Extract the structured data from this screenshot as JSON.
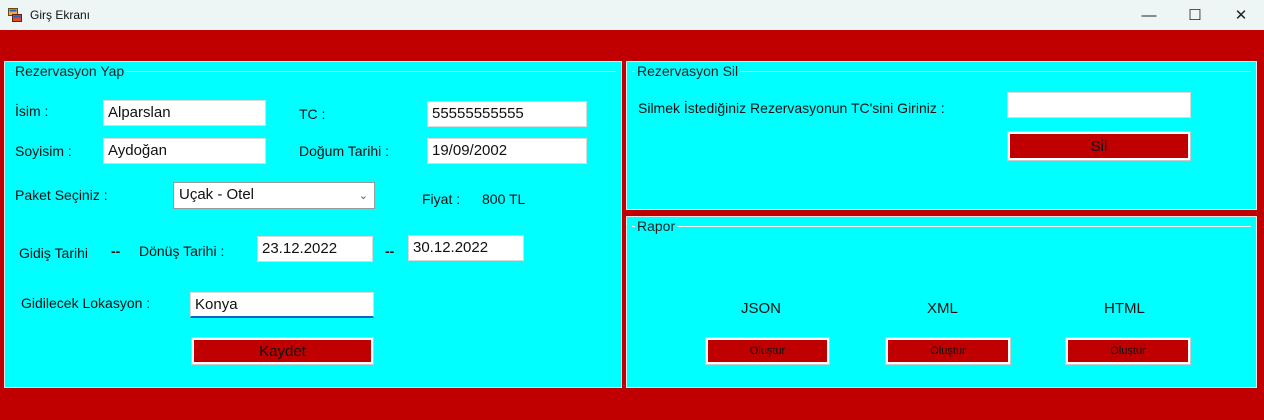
{
  "window": {
    "title": "Girş Ekranı",
    "minimize_glyph": "—",
    "maximize_glyph": "☐",
    "close_glyph": "✕"
  },
  "reservation": {
    "title": "Rezervasyon Yap",
    "name_label": "İsim :",
    "name_value": "Alparslan",
    "tc_label": "TC :",
    "tc_value": "55555555555",
    "surname_label": "Soyisim :",
    "surname_value": "Aydoğan",
    "birth_label": "Doğum Tarihi :",
    "birth_value": "19/09/2002",
    "package_label": "Paket Seçiniz :",
    "package_value": "Uçak - Otel",
    "price_label": "Fiyat :",
    "price_value": "800 TL",
    "departure_label": "Gidiş Tarihi",
    "sep1": "--",
    "return_label": "Dönüş Tarihi :",
    "departure_value": "23.12.2022",
    "sep2": "--",
    "return_value": "30.12.2022",
    "location_label": "Gidilecek Lokasyon :",
    "location_value": "Konya",
    "save_label": "Kaydet"
  },
  "delete": {
    "title": "Rezervasyon Sil",
    "prompt": "Silmek İstediğiniz Rezervasyonun TC'sini Giriniz :",
    "tc_value": "",
    "button_label": "Sil"
  },
  "report": {
    "title": "Rapor",
    "formats": [
      {
        "label": "JSON",
        "button": "Oluştur"
      },
      {
        "label": "XML",
        "button": "Oluştur"
      },
      {
        "label": "HTML",
        "button": "Oluştur"
      }
    ]
  },
  "colors": {
    "background": "#c00000",
    "panel": "#00ffff",
    "button": "#c00000",
    "focus_underline": "#0a64c8"
  }
}
